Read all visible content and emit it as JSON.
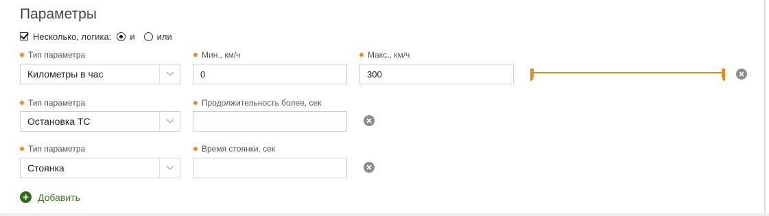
{
  "title": "Параметры",
  "logic": {
    "multiple_label": "Несколько, логика:",
    "multiple_checked": true,
    "options": [
      {
        "label": "и",
        "selected": true
      },
      {
        "label": "или",
        "selected": false
      }
    ]
  },
  "rows": [
    {
      "type_label": "Тип параметра",
      "type_value": "Километры в час",
      "fields": [
        {
          "label": "Мин., км/ч",
          "value": "0"
        },
        {
          "label": "Макс., км/ч",
          "value": "300"
        }
      ],
      "range": {
        "min": 0,
        "max": 300,
        "low": 0,
        "high": 300
      }
    },
    {
      "type_label": "Тип параметра",
      "type_value": "Остановка ТС",
      "fields": [
        {
          "label": "Продолжительность более, сек",
          "value": ""
        }
      ]
    },
    {
      "type_label": "Тип параметра",
      "type_value": "Стоянка",
      "fields": [
        {
          "label": "Время стоянки, сек",
          "value": ""
        }
      ]
    }
  ],
  "add_label": "Добавить",
  "colors": {
    "accent": "#ee8a18",
    "add_green": "#3b7a1c",
    "remove_gray": "#8c8c8c"
  },
  "icons": {
    "remove": "close-circle-icon",
    "dropdown": "chevron-down-icon",
    "add": "plus-circle-icon"
  }
}
